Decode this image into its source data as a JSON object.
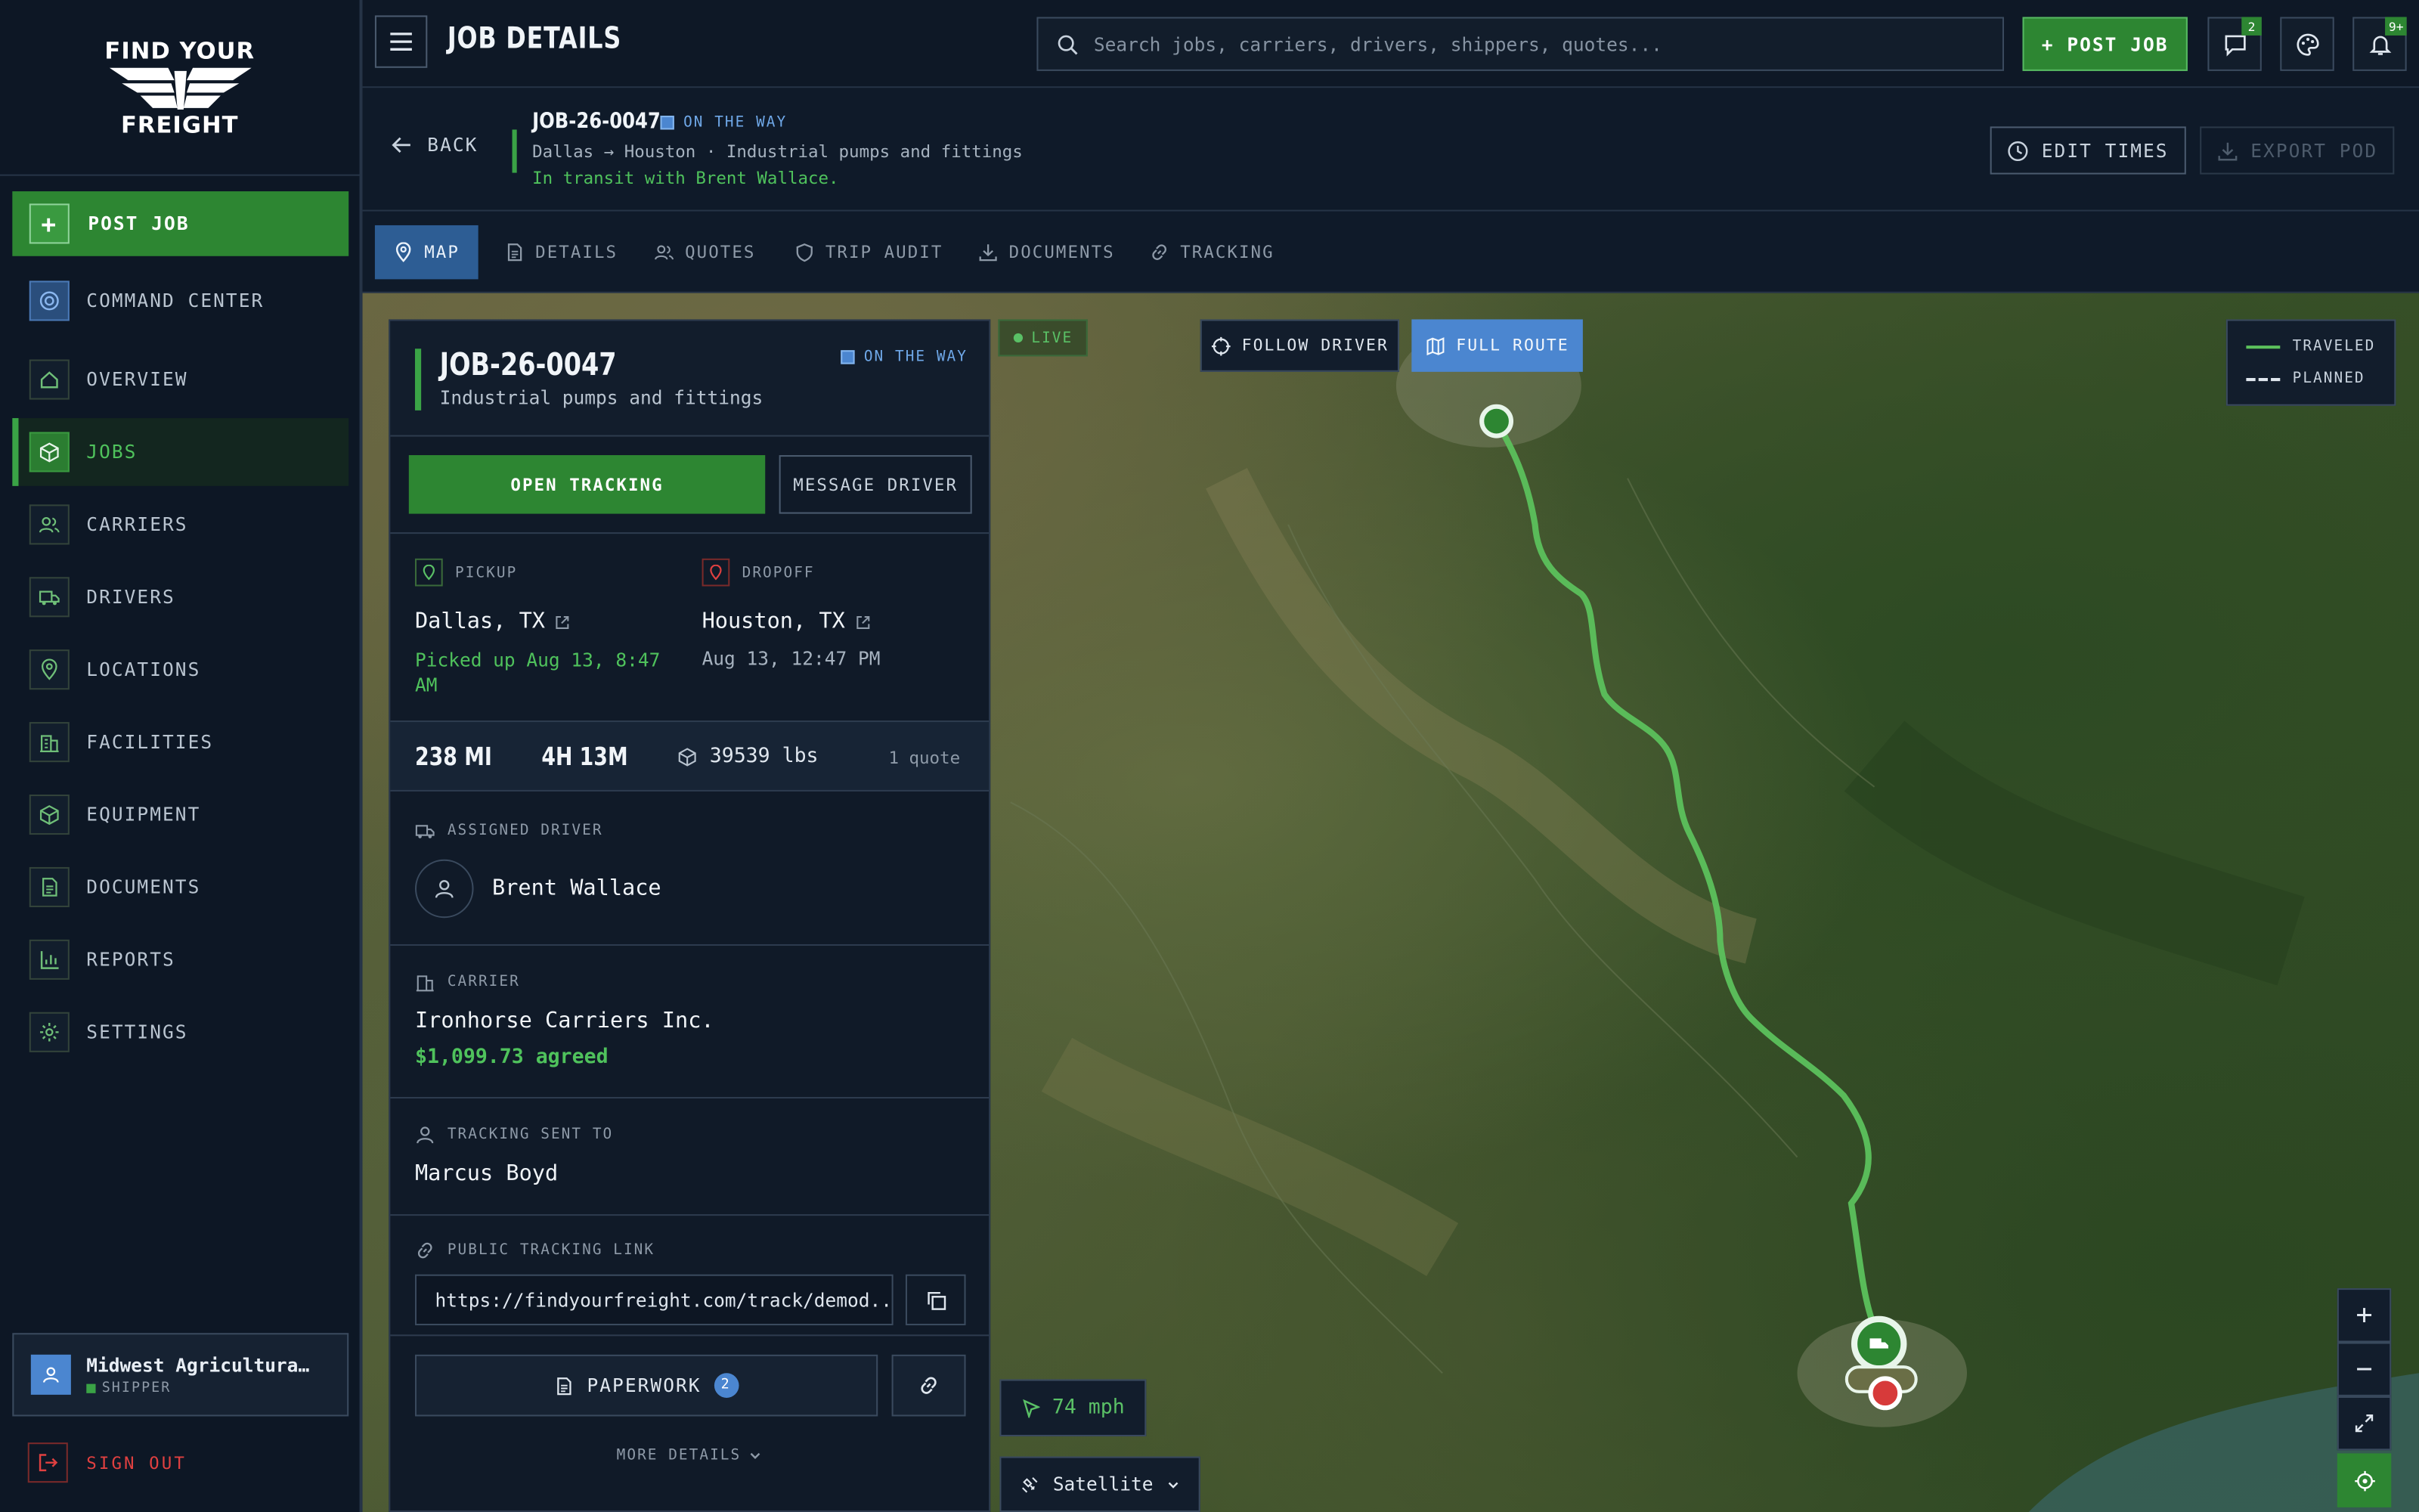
{
  "brand": {
    "logo_top": "FIND YOUR",
    "logo_bottom": "FREIGHT"
  },
  "sidebar": {
    "post_job": "POST JOB",
    "items": [
      {
        "label": "COMMAND CENTER",
        "icon": "radar-icon"
      },
      {
        "label": "OVERVIEW",
        "icon": "home-icon"
      },
      {
        "label": "JOBS",
        "icon": "box-icon",
        "active": true
      },
      {
        "label": "CARRIERS",
        "icon": "users-icon"
      },
      {
        "label": "DRIVERS",
        "icon": "truck-icon"
      },
      {
        "label": "LOCATIONS",
        "icon": "map-pin-icon"
      },
      {
        "label": "FACILITIES",
        "icon": "building-icon"
      },
      {
        "label": "EQUIPMENT",
        "icon": "box-icon"
      },
      {
        "label": "DOCUMENTS",
        "icon": "file-icon"
      },
      {
        "label": "REPORTS",
        "icon": "bar-chart-icon"
      },
      {
        "label": "SETTINGS",
        "icon": "gear-icon"
      }
    ],
    "user": {
      "name": "Midwest Agricultural...",
      "role": "SHIPPER"
    },
    "sign_out": "SIGN OUT"
  },
  "topbar": {
    "title": "JOB DETAILS",
    "search_placeholder": "Search jobs, carriers, drivers, shippers, quotes...",
    "post_job": "+ POST JOB",
    "messages_badge": "2",
    "notifications_badge": "9+"
  },
  "job_header": {
    "back": "BACK",
    "job_id": "JOB-26-0047",
    "status": "ON THE WAY",
    "route": "Dallas → Houston · Industrial pumps and fittings",
    "transit": "In transit with Brent Wallace.",
    "edit_times": "EDIT TIMES",
    "export_pod": "EXPORT POD"
  },
  "tabs": [
    {
      "label": "MAP",
      "icon": "map-pin-icon",
      "active": true
    },
    {
      "label": "DETAILS",
      "icon": "file-icon"
    },
    {
      "label": "QUOTES",
      "icon": "users-icon"
    },
    {
      "label": "TRIP AUDIT",
      "icon": "shield-icon"
    },
    {
      "label": "DOCUMENTS",
      "icon": "download-icon"
    },
    {
      "label": "TRACKING",
      "icon": "link-icon"
    }
  ],
  "card": {
    "job_id": "JOB-26-0047",
    "subtitle": "Industrial pumps and fittings",
    "status": "ON THE WAY",
    "open_tracking": "OPEN TRACKING",
    "message_driver": "MESSAGE DRIVER",
    "pickup": {
      "label": "PICKUP",
      "city": "Dallas, TX",
      "time": "Picked up Aug 13, 8:47 AM"
    },
    "dropoff": {
      "label": "DROPOFF",
      "city": "Houston, TX",
      "time": "Aug 13, 12:47 PM"
    },
    "stats": {
      "distance": "238 MI",
      "duration": "4H 13M",
      "weight": "39539 lbs",
      "quotes": "1 quote"
    },
    "driver": {
      "label": "ASSIGNED DRIVER",
      "name": "Brent Wallace"
    },
    "carrier": {
      "label": "CARRIER",
      "name": "Ironhorse Carriers Inc.",
      "price": "$1,099.73 agreed"
    },
    "tracking_sent": {
      "label": "TRACKING SENT TO",
      "name": "Marcus Boyd"
    },
    "public_link": {
      "label": "PUBLIC TRACKING LINK",
      "url": "https://findyourfreight.com/track/demod..."
    },
    "paperwork": "PAPERWORK",
    "paperwork_count": "2",
    "more_details": "MORE DETAILS"
  },
  "map": {
    "live": "LIVE",
    "follow_driver": "FOLLOW DRIVER",
    "full_route": "FULL ROUTE",
    "legend_traveled": "TRAVELED",
    "legend_planned": "PLANNED",
    "speed": "74 mph",
    "layer": "Satellite",
    "zoom_in": "+",
    "zoom_out": "−"
  },
  "colors": {
    "accent_green": "#2d8632",
    "accent_blue": "#4b86d0",
    "danger": "#e04040",
    "route": "#5cc15c"
  }
}
